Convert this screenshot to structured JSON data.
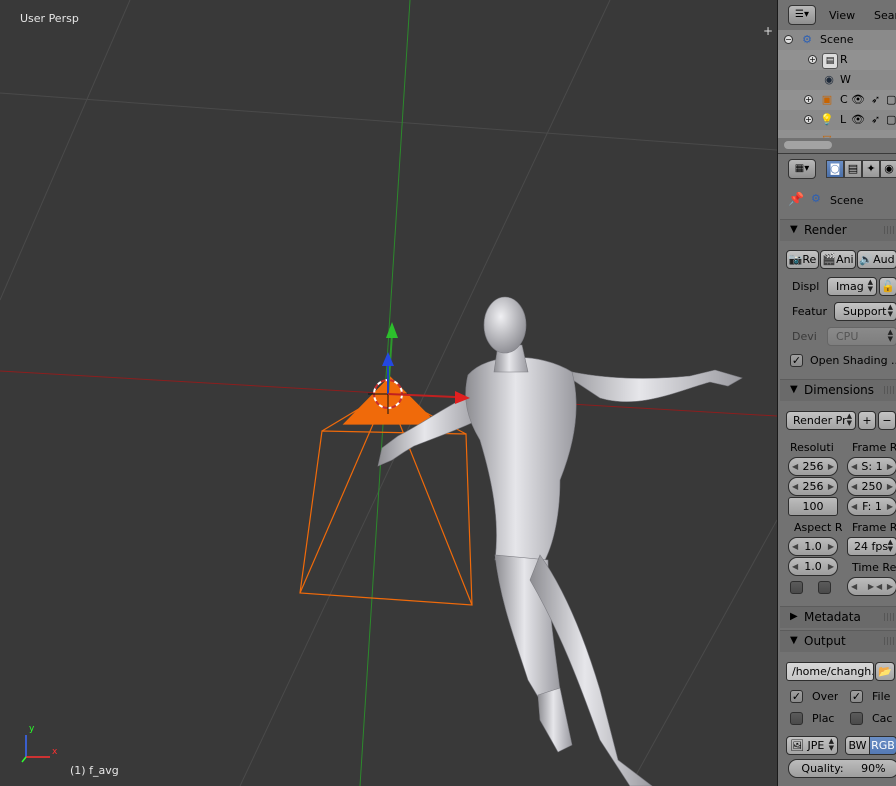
{
  "viewport": {
    "mode_label": "User Persp",
    "object_label": "(1) f_avg",
    "plus_icon": "+",
    "axis_y": "y",
    "axis_x": "x"
  },
  "outliner": {
    "view_menu": "View",
    "search_menu": "Sear",
    "items": [
      {
        "label": "Scene",
        "icon": "scene-icon"
      },
      {
        "label": "R",
        "icon": "render-layers-icon"
      },
      {
        "label": "W",
        "icon": "world-icon"
      },
      {
        "label": "C",
        "icon": "camera-object-icon"
      },
      {
        "label": "L",
        "icon": "lamp-object-icon"
      },
      {
        "label": "",
        "icon": "mesh-object-icon"
      }
    ]
  },
  "properties": {
    "context_label": "Scene",
    "render": {
      "title": "Render",
      "btn_render": "Re",
      "btn_animation": "Ani",
      "btn_audio": "Aud",
      "display_label": "Displ",
      "display_value": "Imag",
      "feature_label": "Featur",
      "feature_value": "Support",
      "device_label": "Devi",
      "device_value": "CPU",
      "open_shading": "Open Shading ..."
    },
    "dimensions": {
      "title": "Dimensions",
      "preset": "Render Pr",
      "resolution_label": "Resoluti",
      "res_x": "256",
      "res_y": "256",
      "res_pct": "100",
      "frame_range_label": "Frame R",
      "frame_start": "S: 1",
      "frame_end": "250",
      "frame_step": "F: 1",
      "aspect_label": "Aspect R",
      "aspect_x": "1.0",
      "aspect_y": "1.0",
      "frame_rate_label": "Frame R",
      "frame_rate": "24 fps",
      "time_remap_label": "Time Re"
    },
    "metadata": {
      "title": "Metadata"
    },
    "output": {
      "title": "Output",
      "path": "/home/changh...",
      "overwrite": "Over",
      "file_ext": "File",
      "placeholders": "Plac",
      "cache": "Cac",
      "format": "JPE",
      "bw": "BW",
      "rgb": "RGB",
      "quality": "Quality:",
      "quality_value": "90%"
    }
  },
  "colors": {
    "viewport_bg": "#393939",
    "selection_orange": "#f06a0a",
    "axis_red": "#9a2020",
    "axis_green": "#2a8a2a",
    "mesh_gray": "#c8c8cc"
  }
}
